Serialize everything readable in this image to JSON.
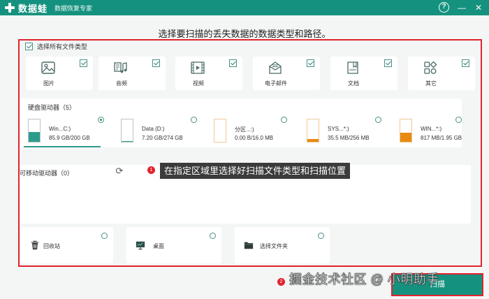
{
  "app": {
    "name": "数据蛙",
    "subtitle": "数据恢复专家",
    "help_icon": "help-icon",
    "minimize_icon": "minimize-icon",
    "close_icon": "close-icon",
    "accent_color": "#15927f",
    "highlight_color": "#e2232d"
  },
  "main": {
    "heading": "选择要扫描的丢失数据的数据类型和路径。",
    "select_all_label": "选择所有文件类型"
  },
  "file_types": [
    {
      "label": "图片",
      "icon": "image-icon",
      "checked": true
    },
    {
      "label": "音频",
      "icon": "audio-icon",
      "checked": true
    },
    {
      "label": "视频",
      "icon": "video-icon",
      "checked": true
    },
    {
      "label": "电子邮件",
      "icon": "email-icon",
      "checked": true
    },
    {
      "label": "文档",
      "icon": "document-icon",
      "checked": true
    },
    {
      "label": "其它",
      "icon": "other-icon",
      "checked": true
    }
  ],
  "disks": {
    "title": "硬盘驱动器（5）",
    "items": [
      {
        "name": "Win...C:)",
        "size": "85.9 GB/200 GB",
        "used_fraction": 0.43,
        "selected": true
      },
      {
        "name": "Data (D:)",
        "size": "7.20 GB/274 GB",
        "used_fraction": 0.03,
        "selected": false
      },
      {
        "name": "分区...:)",
        "size": "0.00  B/16.0 MB",
        "used_fraction": 0.0,
        "selected": false
      },
      {
        "name": "SYS...*:)",
        "size": "35.5 MB/256 MB",
        "used_fraction": 0.14,
        "selected": false
      },
      {
        "name": "WIN...*:)",
        "size": "817 MB/1.95 GB",
        "used_fraction": 0.42,
        "selected": false
      }
    ]
  },
  "removable": {
    "title": "可移动驱动器（0）",
    "refresh_icon": "refresh-icon"
  },
  "locations": [
    {
      "label": "回收站",
      "icon": "recycle-bin-icon"
    },
    {
      "label": "桌面",
      "icon": "desktop-icon"
    },
    {
      "label": "选择文件夹",
      "icon": "folder-icon"
    }
  ],
  "annotation": {
    "step1": "1",
    "step1_text": "在指定区域里选择好扫描文件类型和扫描位置",
    "step2": "2"
  },
  "footer": {
    "watermark": "掘金技术社区 @ 小明助手",
    "scan_button": "扫描"
  }
}
